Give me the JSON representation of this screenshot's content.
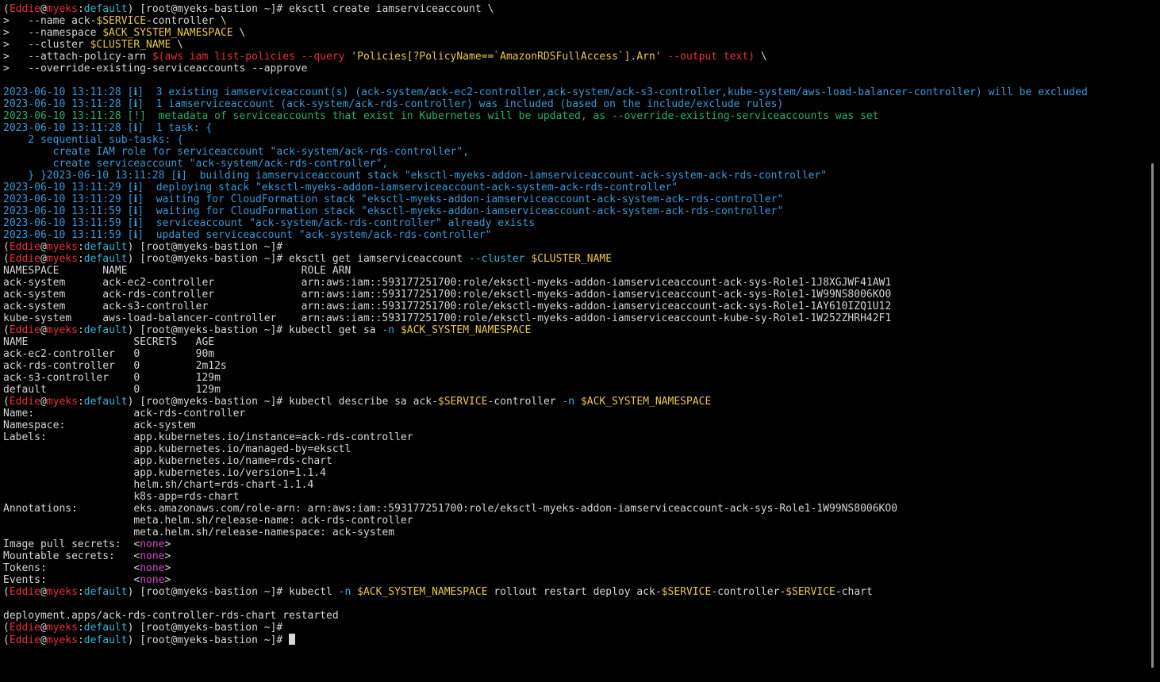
{
  "terminal": {
    "lines": [
      [
        [
          "(",
          "default"
        ],
        [
          "Eddie",
          "red"
        ],
        [
          "@",
          "default"
        ],
        [
          "myeks",
          "red"
        ],
        [
          ":",
          "default"
        ],
        [
          "default",
          "cyan"
        ],
        [
          ") [root@myeks-bastion ~]# eksctl create iamserviceaccount \\",
          "default"
        ]
      ],
      [
        [
          ">   --name ack-",
          "default"
        ],
        [
          "$SERVICE",
          "yellow"
        ],
        [
          "-controller \\",
          "default"
        ]
      ],
      [
        [
          ">   --namespace ",
          "default"
        ],
        [
          "$ACK_SYSTEM_NAMESPACE",
          "yellow"
        ],
        [
          " \\",
          "default"
        ]
      ],
      [
        [
          ">   --cluster ",
          "default"
        ],
        [
          "$CLUSTER_NAME",
          "yellow"
        ],
        [
          " \\",
          "default"
        ]
      ],
      [
        [
          ">   --attach-policy-arn ",
          "default"
        ],
        [
          "$(aws iam list-policies --query ",
          "red"
        ],
        [
          "'Policies[?PolicyName==`AmazonRDSFullAccess`].Arn'",
          "yellow"
        ],
        [
          " --output text)",
          "red"
        ],
        [
          " \\",
          "default"
        ]
      ],
      [
        [
          ">   --override-existing-serviceaccounts --approve",
          "default"
        ]
      ],
      [
        [
          "",
          "default"
        ]
      ],
      [
        [
          "2023-06-10 13:11:28 [ℹ]  3 existing iamserviceaccount(s) (ack-system/ack-ec2-controller,ack-system/ack-s3-controller,kube-system/aws-load-balancer-controller) will be excluded",
          "blue"
        ]
      ],
      [
        [
          "2023-06-10 13:11:28 [ℹ]  1 iamserviceaccount (ack-system/ack-rds-controller) was included (based on the include/exclude rules)",
          "blue"
        ]
      ],
      [
        [
          "2023-06-10 13:11:28 [!]  metadata of serviceaccounts that exist in Kubernetes will be updated, as --override-existing-serviceaccounts was set",
          "green"
        ]
      ],
      [
        [
          "2023-06-10 13:11:28 [ℹ]  1 task: {",
          "blue"
        ]
      ],
      [
        [
          "    2 sequential sub-tasks: {",
          "blue"
        ]
      ],
      [
        [
          "        create IAM role for serviceaccount \"ack-system/ack-rds-controller\",",
          "blue"
        ]
      ],
      [
        [
          "        create serviceaccount \"ack-system/ack-rds-controller\",",
          "blue"
        ]
      ],
      [
        [
          "    } }2023-06-10 13:11:28 [ℹ]  building iamserviceaccount stack \"eksctl-myeks-addon-iamserviceaccount-ack-system-ack-rds-controller\"",
          "blue"
        ]
      ],
      [
        [
          "2023-06-10 13:11:29 [ℹ]  deploying stack \"eksctl-myeks-addon-iamserviceaccount-ack-system-ack-rds-controller\"",
          "blue"
        ]
      ],
      [
        [
          "2023-06-10 13:11:29 [ℹ]  waiting for CloudFormation stack \"eksctl-myeks-addon-iamserviceaccount-ack-system-ack-rds-controller\"",
          "blue"
        ]
      ],
      [
        [
          "2023-06-10 13:11:59 [ℹ]  waiting for CloudFormation stack \"eksctl-myeks-addon-iamserviceaccount-ack-system-ack-rds-controller\"",
          "blue"
        ]
      ],
      [
        [
          "2023-06-10 13:11:59 [ℹ]  serviceaccount \"ack-system/ack-rds-controller\" already exists",
          "blue"
        ]
      ],
      [
        [
          "2023-06-10 13:11:59 [ℹ]  updated serviceaccount \"ack-system/ack-rds-controller\"",
          "blue"
        ]
      ],
      [
        [
          "(",
          "default"
        ],
        [
          "Eddie",
          "red"
        ],
        [
          "@",
          "default"
        ],
        [
          "myeks",
          "red"
        ],
        [
          ":",
          "default"
        ],
        [
          "default",
          "cyan"
        ],
        [
          ") [root@myeks-bastion ~]#",
          "default"
        ]
      ],
      [
        [
          "(",
          "default"
        ],
        [
          "Eddie",
          "red"
        ],
        [
          "@",
          "default"
        ],
        [
          "myeks",
          "red"
        ],
        [
          ":",
          "default"
        ],
        [
          "default",
          "cyan"
        ],
        [
          ") [root@myeks-bastion ~]# eksctl get iamserviceaccount ",
          "default"
        ],
        [
          "--cluster",
          "cyan"
        ],
        [
          " ",
          "default"
        ],
        [
          "$CLUSTER_NAME",
          "yellow"
        ]
      ],
      [
        [
          "NAMESPACE       NAME                            ROLE ARN",
          "default"
        ]
      ],
      [
        [
          "ack-system      ack-ec2-controller              arn:aws:iam::593177251700:role/eksctl-myeks-addon-iamserviceaccount-ack-sys-Role1-1J8XGJWF41AW1",
          "default"
        ]
      ],
      [
        [
          "ack-system      ack-rds-controller              arn:aws:iam::593177251700:role/eksctl-myeks-addon-iamserviceaccount-ack-sys-Role1-1W99NS8006KO0",
          "default"
        ]
      ],
      [
        [
          "ack-system      ack-s3-controller               arn:aws:iam::593177251700:role/eksctl-myeks-addon-iamserviceaccount-ack-sys-Role1-1AY610IZQ1U12",
          "default"
        ]
      ],
      [
        [
          "kube-system     aws-load-balancer-controller    arn:aws:iam::593177251700:role/eksctl-myeks-addon-iamserviceaccount-kube-sy-Role1-1W252ZHRH42F1",
          "default"
        ]
      ],
      [
        [
          "(",
          "default"
        ],
        [
          "Eddie",
          "red"
        ],
        [
          "@",
          "default"
        ],
        [
          "myeks",
          "red"
        ],
        [
          ":",
          "default"
        ],
        [
          "default",
          "cyan"
        ],
        [
          ") [root@myeks-bastion ~]# kubectl get sa ",
          "default"
        ],
        [
          "-n",
          "cyan"
        ],
        [
          " ",
          "default"
        ],
        [
          "$ACK_SYSTEM_NAMESPACE",
          "yellow"
        ]
      ],
      [
        [
          "NAME                 SECRETS   AGE",
          "default"
        ]
      ],
      [
        [
          "ack-ec2-controller   0         90m",
          "default"
        ]
      ],
      [
        [
          "ack-rds-controller   0         2m12s",
          "default"
        ]
      ],
      [
        [
          "ack-s3-controller    0         129m",
          "default"
        ]
      ],
      [
        [
          "default              0         129m",
          "default"
        ]
      ],
      [
        [
          "(",
          "default"
        ],
        [
          "Eddie",
          "red"
        ],
        [
          "@",
          "default"
        ],
        [
          "myeks",
          "red"
        ],
        [
          ":",
          "default"
        ],
        [
          "default",
          "cyan"
        ],
        [
          ") [root@myeks-bastion ~]# kubectl describe sa ack-",
          "default"
        ],
        [
          "$SERVICE",
          "yellow"
        ],
        [
          "-controller ",
          "default"
        ],
        [
          "-n",
          "cyan"
        ],
        [
          " ",
          "default"
        ],
        [
          "$ACK_SYSTEM_NAMESPACE",
          "yellow"
        ]
      ],
      [
        [
          "Name:                ack-rds-controller",
          "default"
        ]
      ],
      [
        [
          "Namespace:           ack-system",
          "default"
        ]
      ],
      [
        [
          "Labels:              app.kubernetes.io/instance=ack-rds-controller",
          "default"
        ]
      ],
      [
        [
          "                     app.kubernetes.io/managed-by=eksctl",
          "default"
        ]
      ],
      [
        [
          "                     app.kubernetes.io/name=rds-chart",
          "default"
        ]
      ],
      [
        [
          "                     app.kubernetes.io/version=1.1.4",
          "default"
        ]
      ],
      [
        [
          "                     helm.sh/chart=rds-chart-1.1.4",
          "default"
        ]
      ],
      [
        [
          "                     k8s-app=rds-chart",
          "default"
        ]
      ],
      [
        [
          "Annotations:         eks.amazonaws.com/role-arn: arn:aws:iam::593177251700:role/eksctl-myeks-addon-iamserviceaccount-ack-sys-Role1-1W99NS8006KO0",
          "default"
        ]
      ],
      [
        [
          "                     meta.helm.sh/release-name: ack-rds-controller",
          "default"
        ]
      ],
      [
        [
          "                     meta.helm.sh/release-namespace: ack-system",
          "default"
        ]
      ],
      [
        [
          "Image pull secrets:  <",
          "default"
        ],
        [
          "none",
          "mag"
        ],
        [
          ">",
          "default"
        ]
      ],
      [
        [
          "Mountable secrets:   <",
          "default"
        ],
        [
          "none",
          "mag"
        ],
        [
          ">",
          "default"
        ]
      ],
      [
        [
          "Tokens:              <",
          "default"
        ],
        [
          "none",
          "mag"
        ],
        [
          ">",
          "default"
        ]
      ],
      [
        [
          "Events:              <",
          "default"
        ],
        [
          "none",
          "mag"
        ],
        [
          ">",
          "default"
        ]
      ],
      [
        [
          "(",
          "default"
        ],
        [
          "Eddie",
          "red"
        ],
        [
          "@",
          "default"
        ],
        [
          "myeks",
          "red"
        ],
        [
          ":",
          "default"
        ],
        [
          "default",
          "cyan"
        ],
        [
          ") [root@myeks-bastion ~]# kubectl ",
          "default"
        ],
        [
          "-n",
          "cyan"
        ],
        [
          " ",
          "default"
        ],
        [
          "$ACK_SYSTEM_NAMESPACE",
          "yellow"
        ],
        [
          " rollout restart deploy ack-",
          "default"
        ],
        [
          "$SERVICE",
          "yellow"
        ],
        [
          "-controller-",
          "default"
        ],
        [
          "$SERVICE",
          "yellow"
        ],
        [
          "-chart",
          "default"
        ]
      ],
      [
        [
          "",
          "default"
        ]
      ],
      [
        [
          "deployment.apps/ack-rds-controller-rds-chart restarted",
          "default"
        ]
      ],
      [
        [
          "(",
          "default"
        ],
        [
          "Eddie",
          "red"
        ],
        [
          "@",
          "default"
        ],
        [
          "myeks",
          "red"
        ],
        [
          ":",
          "default"
        ],
        [
          "default",
          "cyan"
        ],
        [
          ") [root@myeks-bastion ~]#",
          "default"
        ]
      ],
      [
        [
          "(",
          "default"
        ],
        [
          "Eddie",
          "red"
        ],
        [
          "@",
          "default"
        ],
        [
          "myeks",
          "red"
        ],
        [
          ":",
          "default"
        ],
        [
          "default",
          "cyan"
        ],
        [
          ") [root@myeks-bastion ~]# ",
          "default"
        ]
      ]
    ],
    "colors": {
      "background": "#000000",
      "default": "#d6d6d6",
      "red": "#e8303c",
      "cyan": "#3cb4d4",
      "yellow": "#e8c84c",
      "mag": "#d04cc8",
      "green": "#28b068",
      "blue": "#3a9ad8",
      "scrollbar": "#8a8a8a"
    }
  }
}
